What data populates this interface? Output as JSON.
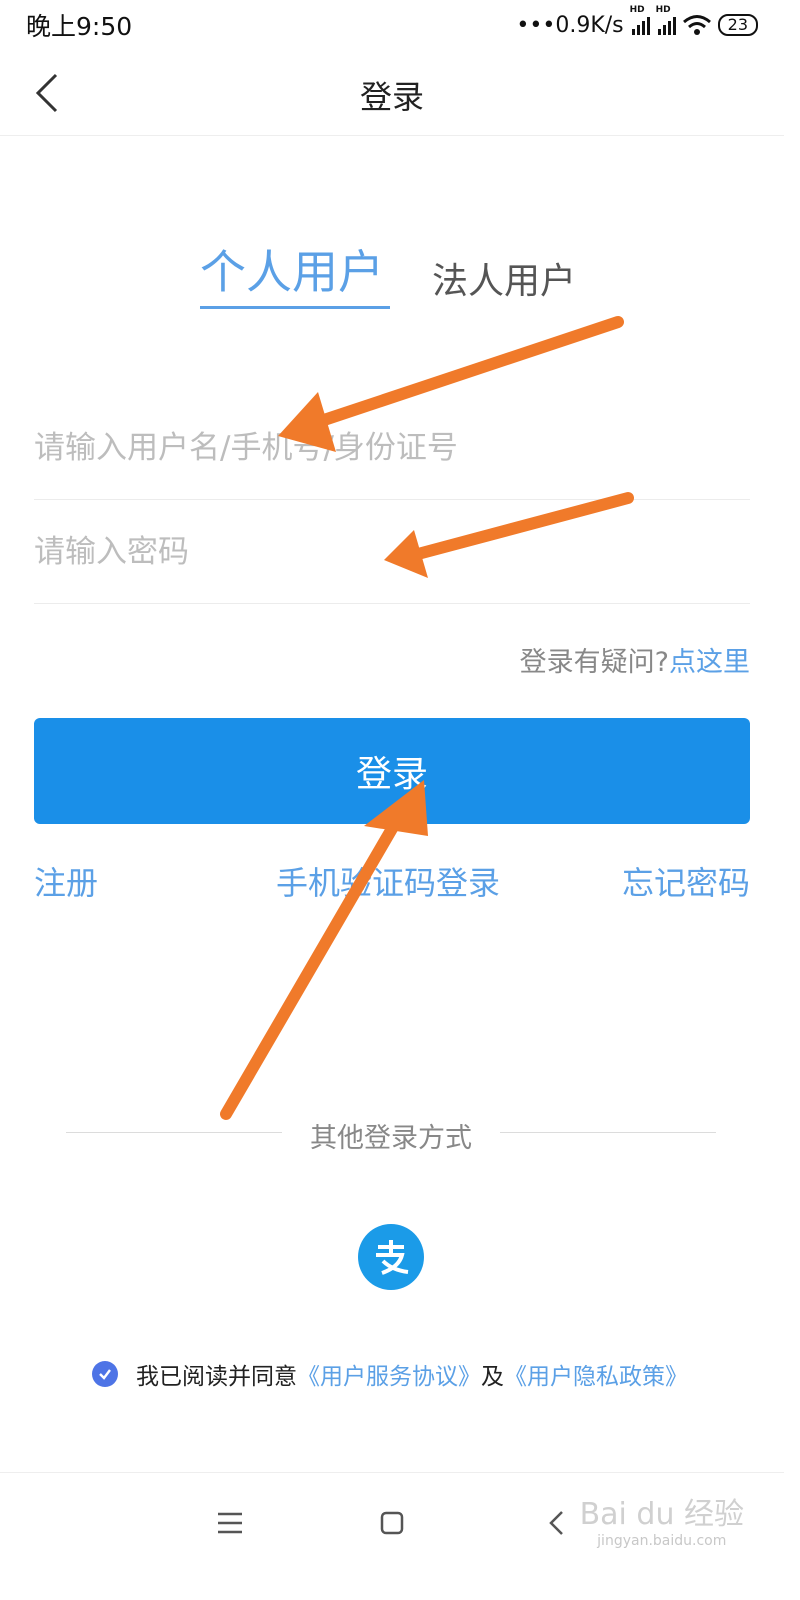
{
  "status_bar": {
    "time": "晚上9:50",
    "network_speed": "•••0.9K/s",
    "battery": "23"
  },
  "nav": {
    "title": "登录"
  },
  "tabs": {
    "personal": "个人用户",
    "corporate": "法人用户",
    "active": "personal"
  },
  "form": {
    "username_placeholder": "请输入用户名/手机号/身份证号",
    "username_value": "",
    "password_placeholder": "请输入密码",
    "password_value": ""
  },
  "help": {
    "question": "登录有疑问?",
    "link": "点这里"
  },
  "login_button": "登录",
  "links": {
    "register": "注册",
    "sms_login": "手机验证码登录",
    "forgot_password": "忘记密码"
  },
  "other_login": {
    "label": "其他登录方式",
    "alipay_icon": "支"
  },
  "agreement": {
    "checked": true,
    "prefix": "我已阅读并同意",
    "service_agreement": "《用户服务协议》",
    "conjunction": "及",
    "privacy_policy": "《用户隐私政策》"
  },
  "watermark": {
    "brand": "Bai du 经验",
    "url": "jingyan.baidu.com"
  },
  "colors": {
    "accent": "#5ba0e6",
    "primary_button": "#1a8fe8",
    "arrow": "#f07a2a",
    "checkbox": "#4e74e6"
  }
}
